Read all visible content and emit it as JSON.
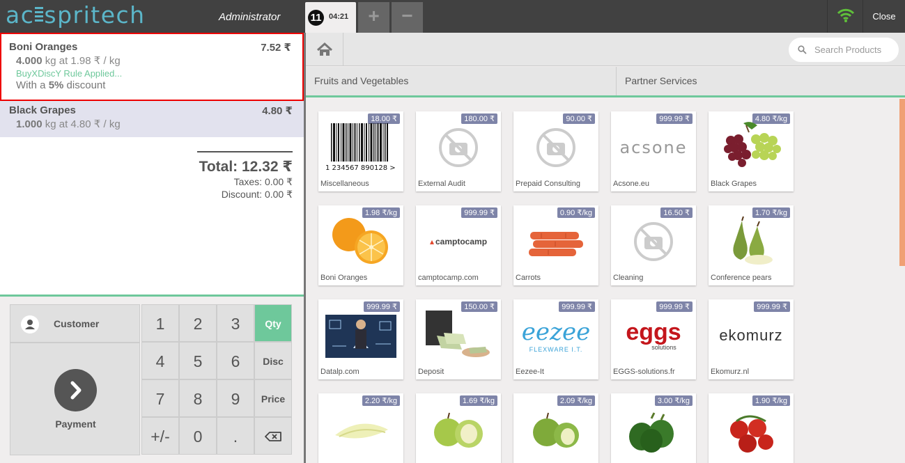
{
  "header": {
    "logo_left": "ac",
    "logo_right": "spritech",
    "user": "Administrator",
    "order_number": "11",
    "order_time": "04:21",
    "add_label": "+",
    "remove_label": "−",
    "close_label": "Close"
  },
  "order": {
    "lines": [
      {
        "name": "Boni Oranges",
        "price": "7.52 ₹",
        "qty": "4.000",
        "unit_info": "kg at 1.98 ₹ / kg",
        "rule": "BuyXDiscY Rule Applied...",
        "discount_prefix": "With a",
        "discount_value": "5%",
        "discount_suffix": "discount"
      },
      {
        "name": "Black Grapes",
        "price": "4.80 ₹",
        "qty": "1.000",
        "unit_info": "kg at 4.80 ₹ / kg"
      }
    ],
    "total": "Total: 12.32 ₹",
    "taxes": "Taxes: 0.00 ₹",
    "discount": "Discount: 0.00 ₹"
  },
  "pad": {
    "customer": "Customer",
    "payment": "Payment",
    "keys": [
      "1",
      "2",
      "3",
      "4",
      "5",
      "6",
      "7",
      "8",
      "9",
      "+/-",
      "0",
      "."
    ],
    "modes": [
      "Qty",
      "Disc",
      "Price"
    ],
    "active_mode": "Qty"
  },
  "search": {
    "placeholder": "Search Products"
  },
  "categories": [
    "Fruits and Vegetables",
    "Partner Services"
  ],
  "products": [
    {
      "name": "Miscellaneous",
      "price": "18.00 ₹",
      "img": "barcode-icon"
    },
    {
      "name": "External Audit",
      "price": "180.00 ₹",
      "img": "no-image-icon"
    },
    {
      "name": "Prepaid Consulting",
      "price": "90.00 ₹",
      "img": "no-image-icon"
    },
    {
      "name": "Acsone.eu",
      "price": "999.99 ₹",
      "img": "acsone-logo",
      "logo_text": "acsone"
    },
    {
      "name": "Black Grapes",
      "price": "4.80 ₹/kg",
      "img": "grapes-image"
    },
    {
      "name": "Boni Oranges",
      "price": "1.98 ₹/kg",
      "img": "oranges-image"
    },
    {
      "name": "camptocamp.com",
      "price": "999.99 ₹",
      "img": "camptocamp-logo",
      "logo_text": "camptocamp"
    },
    {
      "name": "Carrots",
      "price": "0.90 ₹/kg",
      "img": "carrots-image"
    },
    {
      "name": "Cleaning",
      "price": "16.50 ₹",
      "img": "no-image-icon"
    },
    {
      "name": "Conference pears",
      "price": "1.70 ₹/kg",
      "img": "pears-image"
    },
    {
      "name": "Datalp.com",
      "price": "999.99 ₹",
      "img": "datalp-image"
    },
    {
      "name": "Deposit",
      "price": "150.00 ₹",
      "img": "money-image"
    },
    {
      "name": "Eezee-It",
      "price": "999.99 ₹",
      "img": "eezee-logo",
      "logo_text": "eezee",
      "logo_sub": "FLEXWARE I.T."
    },
    {
      "name": "EGGS-solutions.fr",
      "price": "999.99 ₹",
      "img": "eggs-logo",
      "logo_text": "eggs",
      "logo_sub": "solutions"
    },
    {
      "name": "Ekomurz.nl",
      "price": "999.99 ₹",
      "img": "ekomurz-logo",
      "logo_text": "ekomurz"
    },
    {
      "name": "",
      "price": "2.20 ₹/kg",
      "img": "endive-image"
    },
    {
      "name": "",
      "price": "1.69 ₹/kg",
      "img": "apples-image"
    },
    {
      "name": "",
      "price": "2.09 ₹/kg",
      "img": "green-apples-image"
    },
    {
      "name": "",
      "price": "3.00 ₹/kg",
      "img": "peppers-image"
    },
    {
      "name": "",
      "price": "1.90 ₹/kg",
      "img": "tomatoes-image"
    }
  ],
  "colors": {
    "accent": "#6ec89b",
    "topbar": "#414141",
    "price_tag": "#7e84a8",
    "selection": "#ee0000"
  }
}
